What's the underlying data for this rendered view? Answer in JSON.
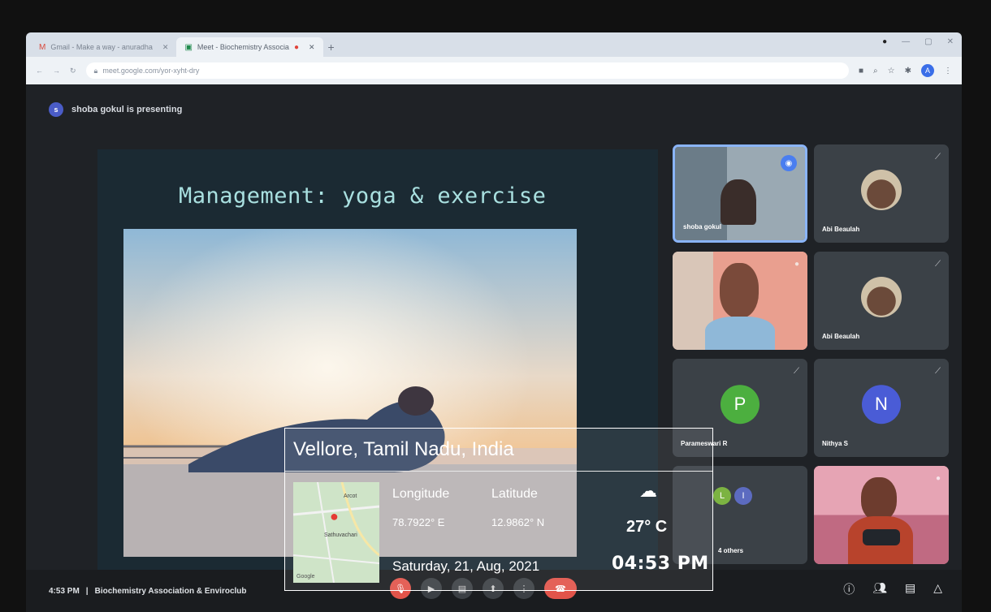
{
  "browser": {
    "tabs": [
      {
        "label": "Gmail - Make a way - anuradha",
        "icon": "gmail-icon",
        "active": false
      },
      {
        "label": "Meet - Biochemistry Associa",
        "icon": "meet-icon",
        "active": true
      }
    ],
    "url": "meet.google.com/yor-xyht-dry"
  },
  "meet": {
    "presenter_initial": "s",
    "presenting_text": "shoba gokul is presenting",
    "slide_title": "Management: yoga & exercise",
    "participants": [
      {
        "name": "shoba gokul",
        "type": "video"
      },
      {
        "name": "Abi Beaulah",
        "type": "photo"
      },
      {
        "name": "",
        "type": "video"
      },
      {
        "name": "Abi Beaulah",
        "type": "photo"
      },
      {
        "name": "Parameswari R",
        "initial": "P",
        "color": "#4caf3f"
      },
      {
        "name": "Nithya S",
        "initial": "N",
        "color": "#4a5cd6"
      },
      {
        "name": "4 others",
        "initials": [
          "L",
          "I"
        ],
        "colors": [
          "#7cb342",
          "#5c6bc0"
        ]
      },
      {
        "name": "",
        "type": "video"
      }
    ],
    "meeting_time": "4:53 PM",
    "meeting_divider": "|",
    "meeting_name": "Biochemistry Association & Enviroclub"
  },
  "gps_overlay": {
    "place": "Vellore, Tamil Nadu, India",
    "longitude_label": "Longitude",
    "latitude_label": "Latitude",
    "longitude_value": "78.7922° E",
    "latitude_value": "12.9862° N",
    "temperature": "27° C",
    "time": "04:53 PM",
    "date": "Saturday, 21, Aug, 2021",
    "map_label_top": "Arcot",
    "map_label_mid": "Sathuvachari",
    "map_label_bottom": "Google"
  }
}
